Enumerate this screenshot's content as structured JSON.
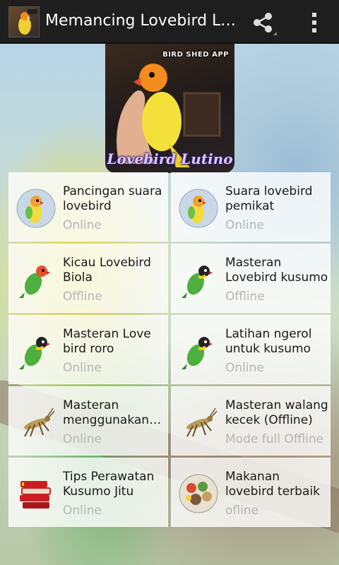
{
  "app": {
    "title": "Memancing Lovebird Luti…"
  },
  "header": {
    "tag": "BIRD SHED APP",
    "caption": "Lovebird Lutino"
  },
  "items": [
    {
      "title": "Pancingan suara lovebird",
      "status": "Online",
      "icon": "lutino-lovebird-icon"
    },
    {
      "title": "Suara lovebird pemikat",
      "status": "Online",
      "icon": "lutino-lovebird-icon"
    },
    {
      "title": "Kicau Lovebird Biola",
      "status": "Offline",
      "icon": "green-lovebird-icon"
    },
    {
      "title": "Masteran Lovebird kusumo",
      "status": "Offline",
      "icon": "green-lovebird-icon"
    },
    {
      "title": "Masteran Love bird roro",
      "status": "Online",
      "icon": "green-lovebird-icon"
    },
    {
      "title": "Latihan ngerol untuk kusumo",
      "status": "Online",
      "icon": "green-lovebird-icon"
    },
    {
      "title": "Masteran menggunakan…",
      "status": "Online",
      "icon": "grasshopper-icon"
    },
    {
      "title": "Masteran walang kecek (Offline)",
      "status": "Mode full Offline",
      "icon": "grasshopper-icon"
    },
    {
      "title": "Tips Perawatan Kusumo Jitu",
      "status": "Online",
      "icon": "books-icon"
    },
    {
      "title": "Makanan lovebird terbaik",
      "status": "ofline",
      "icon": "bird-food-icon"
    }
  ],
  "colors": {
    "actionbar": "#1e1e1e",
    "title_text": "#ffffff",
    "card_bg": "#ffffffcc",
    "status_text": "#b5b5b5"
  }
}
